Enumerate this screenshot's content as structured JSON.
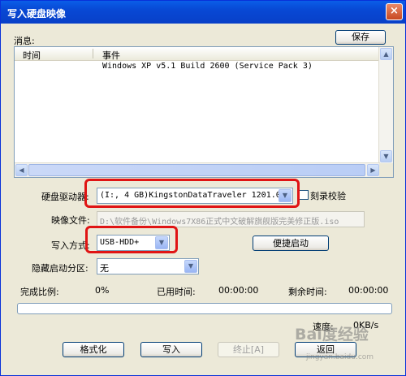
{
  "window": {
    "title": "写入硬盘映像",
    "close_glyph": "×"
  },
  "messages": {
    "label": "消息:",
    "save_button": "保存"
  },
  "log": {
    "columns": [
      "时间",
      "事件"
    ],
    "rows": [
      {
        "time": "",
        "event": "Windows XP v5.1 Build 2600 (Service Pack 3)"
      }
    ]
  },
  "drive": {
    "label": "硬盘驱动器:",
    "value": "(I:, 4 GB)KingstonDataTraveler 1201.00",
    "verify_label": "刻录校验",
    "verify_checked": false
  },
  "image": {
    "label": "映像文件:",
    "value": "D:\\软件备份\\Windows7X86正式中文破解旗舰版完美修正版.iso"
  },
  "write_mode": {
    "label": "写入方式:",
    "value": "USB-HDD+",
    "boot_button": "便捷启动"
  },
  "hidden_partition": {
    "label": "隐藏启动分区:",
    "value": "无"
  },
  "stats": {
    "completed_label": "完成比例:",
    "completed_value": "0%",
    "elapsed_label": "已用时间:",
    "elapsed_value": "00:00:00",
    "remaining_label": "剩余时间:",
    "remaining_value": "00:00:00",
    "progress": 0,
    "speed_label": "速度:",
    "speed_value": "0KB/s"
  },
  "buttons": {
    "format": "格式化",
    "write": "写入",
    "abort": "终止[A]",
    "back": "返回"
  },
  "watermark": {
    "brand": "Bai度经验",
    "url": "jingyan.baidu.com"
  },
  "colors": {
    "titlebar": "#0a5ee8",
    "highlight": "#e01414",
    "dialog_bg": "#ece9d8"
  }
}
